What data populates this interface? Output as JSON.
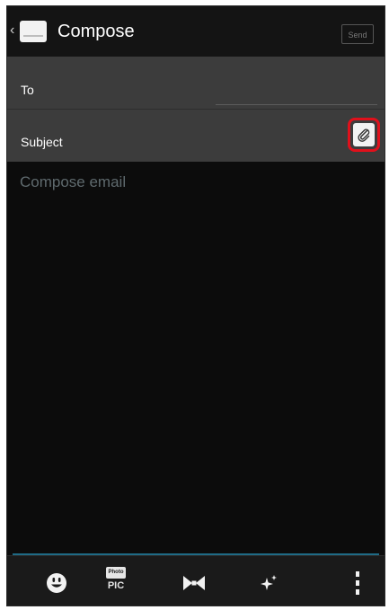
{
  "action_bar": {
    "back_glyph": "‹",
    "app_icon": "email-app-icon",
    "title": "Compose",
    "send_label": "Send"
  },
  "fields": {
    "to_label": "To",
    "subject_label": "Subject",
    "attach_icon": "paperclip-icon"
  },
  "body": {
    "placeholder": "Compose email"
  },
  "toolbar": {
    "items": [
      {
        "icon": "emoji-icon"
      },
      {
        "icon": "photo-pic-icon",
        "badge_top": "Photo",
        "badge_label": "PIC"
      },
      {
        "icon": "bowtie-icon"
      },
      {
        "icon": "sparkle-icon"
      },
      {
        "icon": "more-vert-icon"
      }
    ]
  },
  "colors": {
    "background": "#0b0b0b",
    "fields_background": "#3c3c3c",
    "highlight": "#e0101b",
    "accent": "#1f6b86"
  }
}
